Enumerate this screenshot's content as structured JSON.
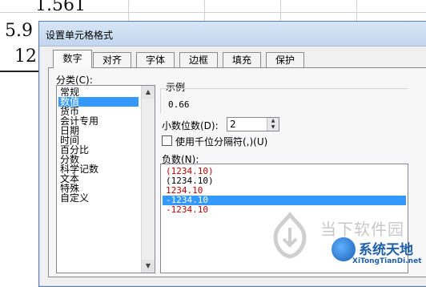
{
  "sheet": {
    "cells": [
      "1.561",
      "5.9",
      "12."
    ]
  },
  "dialog": {
    "title": "设置单元格格式",
    "tabs": [
      {
        "label": "数字"
      },
      {
        "label": "对齐"
      },
      {
        "label": "字体"
      },
      {
        "label": "边框"
      },
      {
        "label": "填充"
      },
      {
        "label": "保护"
      }
    ],
    "category_label": "分类(C):",
    "categories": [
      "常规",
      "数值",
      "货币",
      "会计专用",
      "日期",
      "时间",
      "百分比",
      "分数",
      "科学记数",
      "文本",
      "特殊",
      "自定义"
    ],
    "selected_category": "数值",
    "sample_label": "示例",
    "sample_value": "0.66",
    "decimal_label": "小数位数(D):",
    "decimal_value": "2",
    "separator_label": "使用千位分隔符(,)(U)",
    "negative_label": "负数(N):",
    "negative_options": [
      {
        "text": "(1234.10)",
        "color": "#c00000"
      },
      {
        "text": "(1234.10)",
        "color": "#000000"
      },
      {
        "text": "1234.10",
        "color": "#c00000"
      },
      {
        "text": "-1234.10",
        "color": "#ffffff",
        "selected": true
      },
      {
        "text": "-1234.10",
        "color": "#c00000"
      }
    ]
  },
  "watermark": {
    "brand": "当下软件园",
    "logo_text": "系统天地",
    "url": "XiTongTianDi.net"
  }
}
